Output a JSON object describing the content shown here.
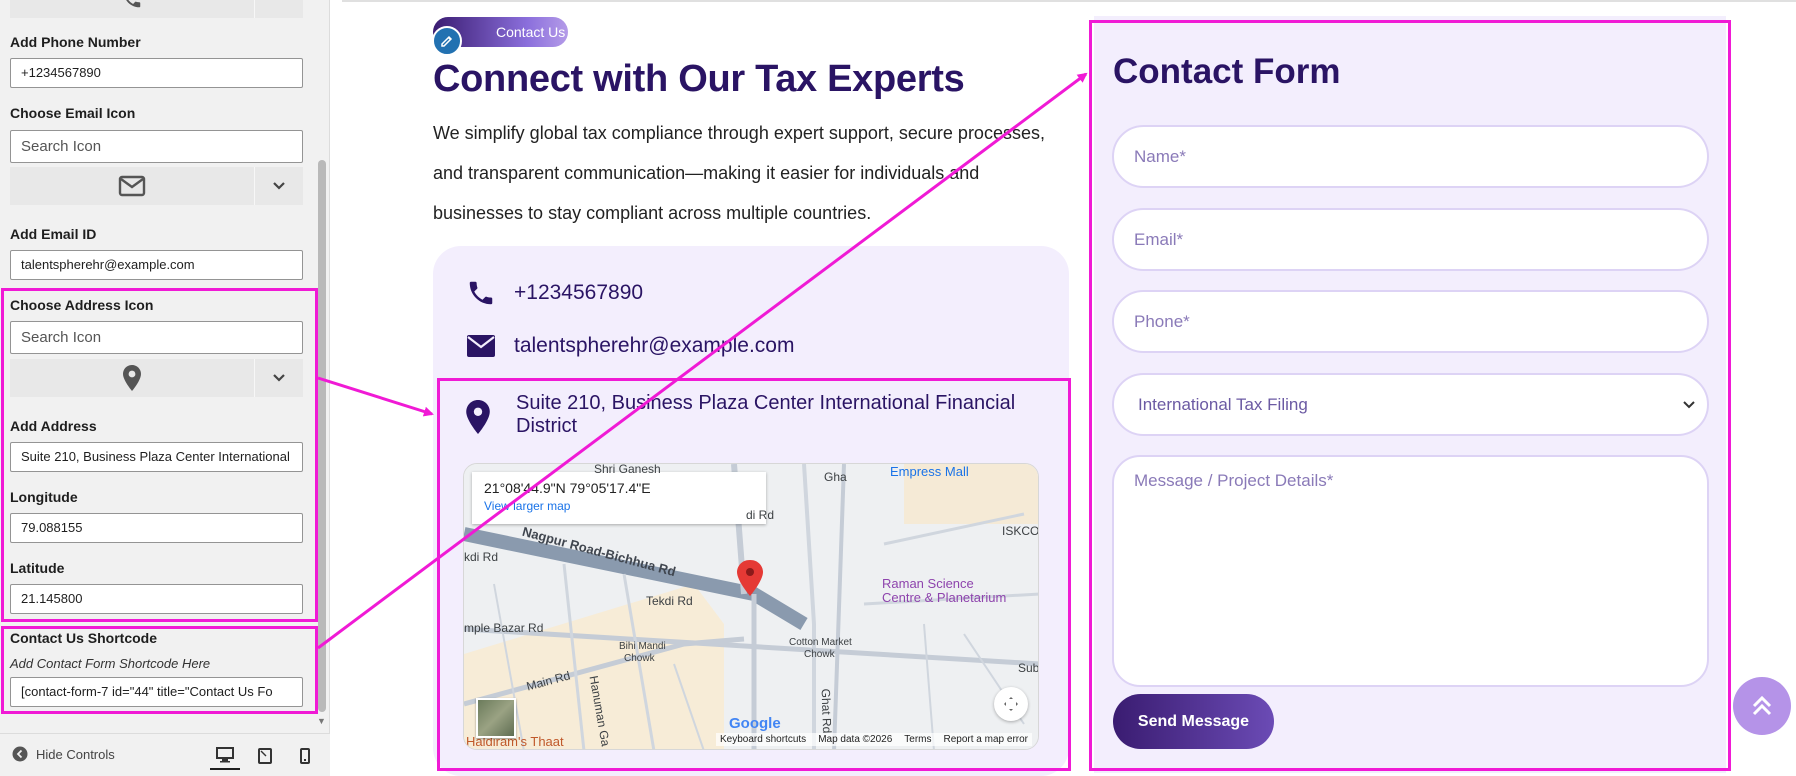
{
  "sidebar": {
    "phone_label": "Add Phone Number",
    "phone_value": "+1234567890",
    "email_icon_label": "Choose Email Icon",
    "email_icon_search": "Search Icon",
    "email_label": "Add Email ID",
    "email_value": "talentspherehr@example.com",
    "address_icon_label": "Choose Address Icon",
    "address_icon_search": "Search Icon",
    "address_label": "Add Address",
    "address_value": "Suite 210, Business Plaza Center International",
    "longitude_label": "Longitude",
    "longitude_value": "79.088155",
    "latitude_label": "Latitude",
    "latitude_value": "21.145800",
    "shortcode_label": "Contact Us Shortcode",
    "shortcode_help": "Add Contact Form Shortcode Here",
    "shortcode_value": "[contact-form-7 id=\"44\" title=\"Contact Us Fo",
    "hide_controls": "Hide Controls"
  },
  "main": {
    "badge": "Contact Us",
    "heading": "Connect with Our Tax Experts",
    "paragraph": "We simplify global tax compliance through expert support, secure processes, and transparent communication—making it easier for individuals and businesses to stay compliant across multiple countries.",
    "phone": "+1234567890",
    "email": "talentspherehr@example.com",
    "address": "Suite 210, Business Plaza Center International Financial District"
  },
  "map": {
    "coords": "21°08'44.9\"N 79°05'17.4\"E",
    "view_larger": "View larger map",
    "labels": {
      "shri_ganesh": "Shri Ganesh",
      "empress_mall": "Empress Mall",
      "iskcon": "ISKCON Na",
      "nagpur_road": "Nagpur Road-Bichhua Rd",
      "kdi_rd": "kdi Rd",
      "tekdi_rd": "Tekdi Rd",
      "raman_science": "Raman Science",
      "planetarium": "Centre & Planetarium",
      "imple_bazar": "mple Bazar Rd",
      "bihi_mandi": "Bihi Mandi",
      "chowk": "Chowk",
      "cotton_market": "Cotton Market",
      "cotton_chowk": "Chowk",
      "main_rd": "Main Rd",
      "hanuman": "Hanuman Ga",
      "ghat_rd": "Ghat Rd",
      "sub": "Sub",
      "haldiram": "Haldiram's Thaat",
      "gha": "Gha",
      "di_rd": "di Rd"
    },
    "google": "Google",
    "keyboard": "Keyboard shortcuts",
    "map_data": "Map data ©2026",
    "terms": "Terms",
    "report": "Report a map error"
  },
  "form": {
    "title": "Contact Form",
    "name_placeholder": "Name*",
    "email_placeholder": "Email*",
    "phone_placeholder": "Phone*",
    "service_selected": "International Tax Filing",
    "message_placeholder": "Message / Project Details*",
    "send_label": "Send Message"
  },
  "colors": {
    "accent_dark": "#2a1464",
    "annotation": "#f01ad5",
    "card_bg": "#f3eefd"
  }
}
